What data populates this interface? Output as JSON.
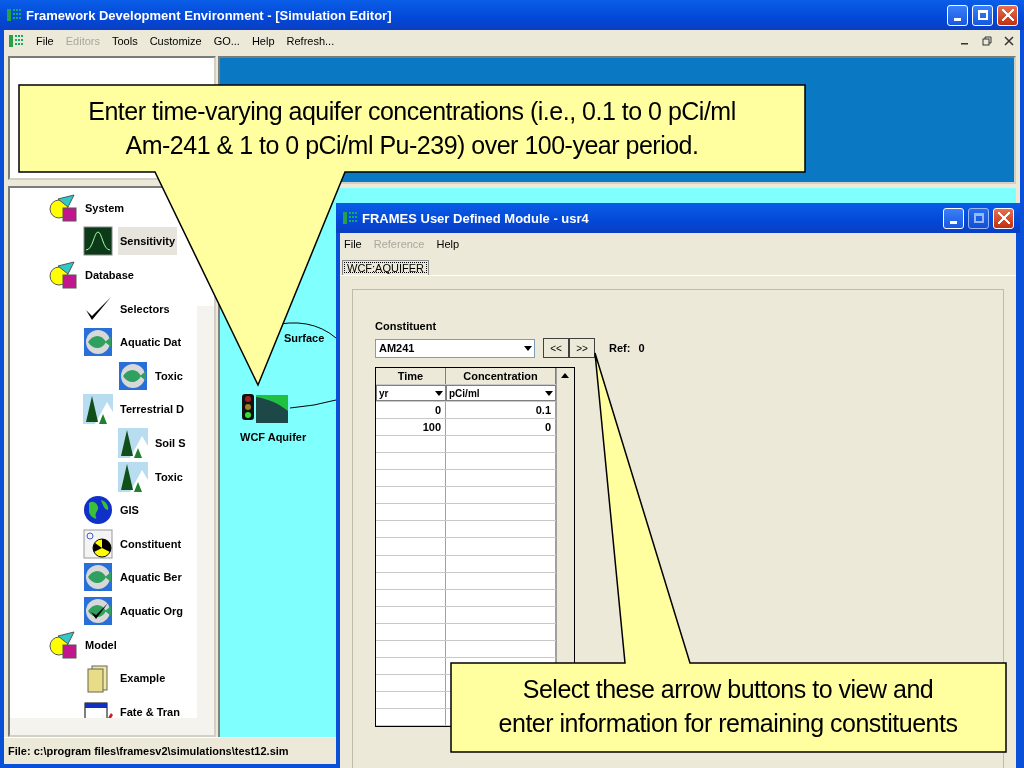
{
  "window": {
    "title": "Framework Development Environment - [Simulation Editor]"
  },
  "menu": [
    {
      "label": "File",
      "disabled": false
    },
    {
      "label": "Editors",
      "disabled": true
    },
    {
      "label": "Tools",
      "disabled": false
    },
    {
      "label": "Customize",
      "disabled": false
    },
    {
      "label": "GO...",
      "disabled": false
    },
    {
      "label": "Help",
      "disabled": false
    },
    {
      "label": "Refresh...",
      "disabled": false
    }
  ],
  "tree": {
    "items": [
      {
        "label": "System",
        "kind": "group",
        "selected": false,
        "children": [
          {
            "label": "Sensitivity",
            "kind": "wave",
            "selected": true
          }
        ]
      },
      {
        "label": "Database",
        "kind": "group",
        "selected": false,
        "children": [
          {
            "label": "Selectors",
            "kind": "check",
            "selected": false
          },
          {
            "label": "Aquatic Dat",
            "kind": "fish",
            "selected": false,
            "children": [
              {
                "label": "Toxic",
                "kind": "fish",
                "selected": false
              }
            ]
          },
          {
            "label": "Terrestrial D",
            "kind": "tree",
            "selected": false,
            "children": [
              {
                "label": "Soil S",
                "kind": "tree",
                "selected": false
              },
              {
                "label": "Toxic",
                "kind": "tree",
                "selected": false
              }
            ]
          },
          {
            "label": "GIS",
            "kind": "globe",
            "selected": false
          },
          {
            "label": "Constituent",
            "kind": "radiation",
            "selected": false
          },
          {
            "label": "Aquatic Ber",
            "kind": "fish",
            "selected": false
          },
          {
            "label": "Aquatic Org",
            "kind": "fishcheck",
            "selected": false
          }
        ]
      },
      {
        "label": "Model",
        "kind": "group",
        "selected": false,
        "children": [
          {
            "label": "Example",
            "kind": "folder",
            "selected": false
          },
          {
            "label": "Fate & Tran",
            "kind": "form",
            "selected": false
          }
        ]
      }
    ]
  },
  "canvas": {
    "nodes": [
      {
        "label": "Surface"
      },
      {
        "label": "WCF Aquifer"
      }
    ]
  },
  "status_bar": "File: c:\\program files\\framesv2\\simulations\\test12.sim",
  "module_window": {
    "title": "FRAMES User Defined Module - usr4",
    "menu": [
      {
        "label": "File",
        "disabled": false
      },
      {
        "label": "Reference",
        "disabled": true
      },
      {
        "label": "Help",
        "disabled": false
      }
    ],
    "tabs": [
      {
        "label": "WCF:AQUIFER",
        "selected": true
      }
    ],
    "constituent_label": "Constituent",
    "constituent": "AM241",
    "prev_button": "<<",
    "next_button": ">>",
    "ref_label": "Ref:",
    "ref_value": "0",
    "table": {
      "columns": [
        "Time",
        "Concentration"
      ],
      "units": [
        "yr",
        "pCi/ml"
      ],
      "rows": [
        [
          "0",
          "0.1"
        ],
        [
          "100",
          "0"
        ]
      ]
    }
  },
  "callouts": [
    {
      "lines": [
        "Enter time-varying aquifer concentrations (i.e., 0.1 to 0 pCi/ml",
        "Am-241 & 1 to 0 pCi/ml Pu-239) over 100-year period."
      ]
    },
    {
      "lines": [
        "Select these arrow buttons to view and",
        "enter information for remaining constituents"
      ]
    }
  ]
}
